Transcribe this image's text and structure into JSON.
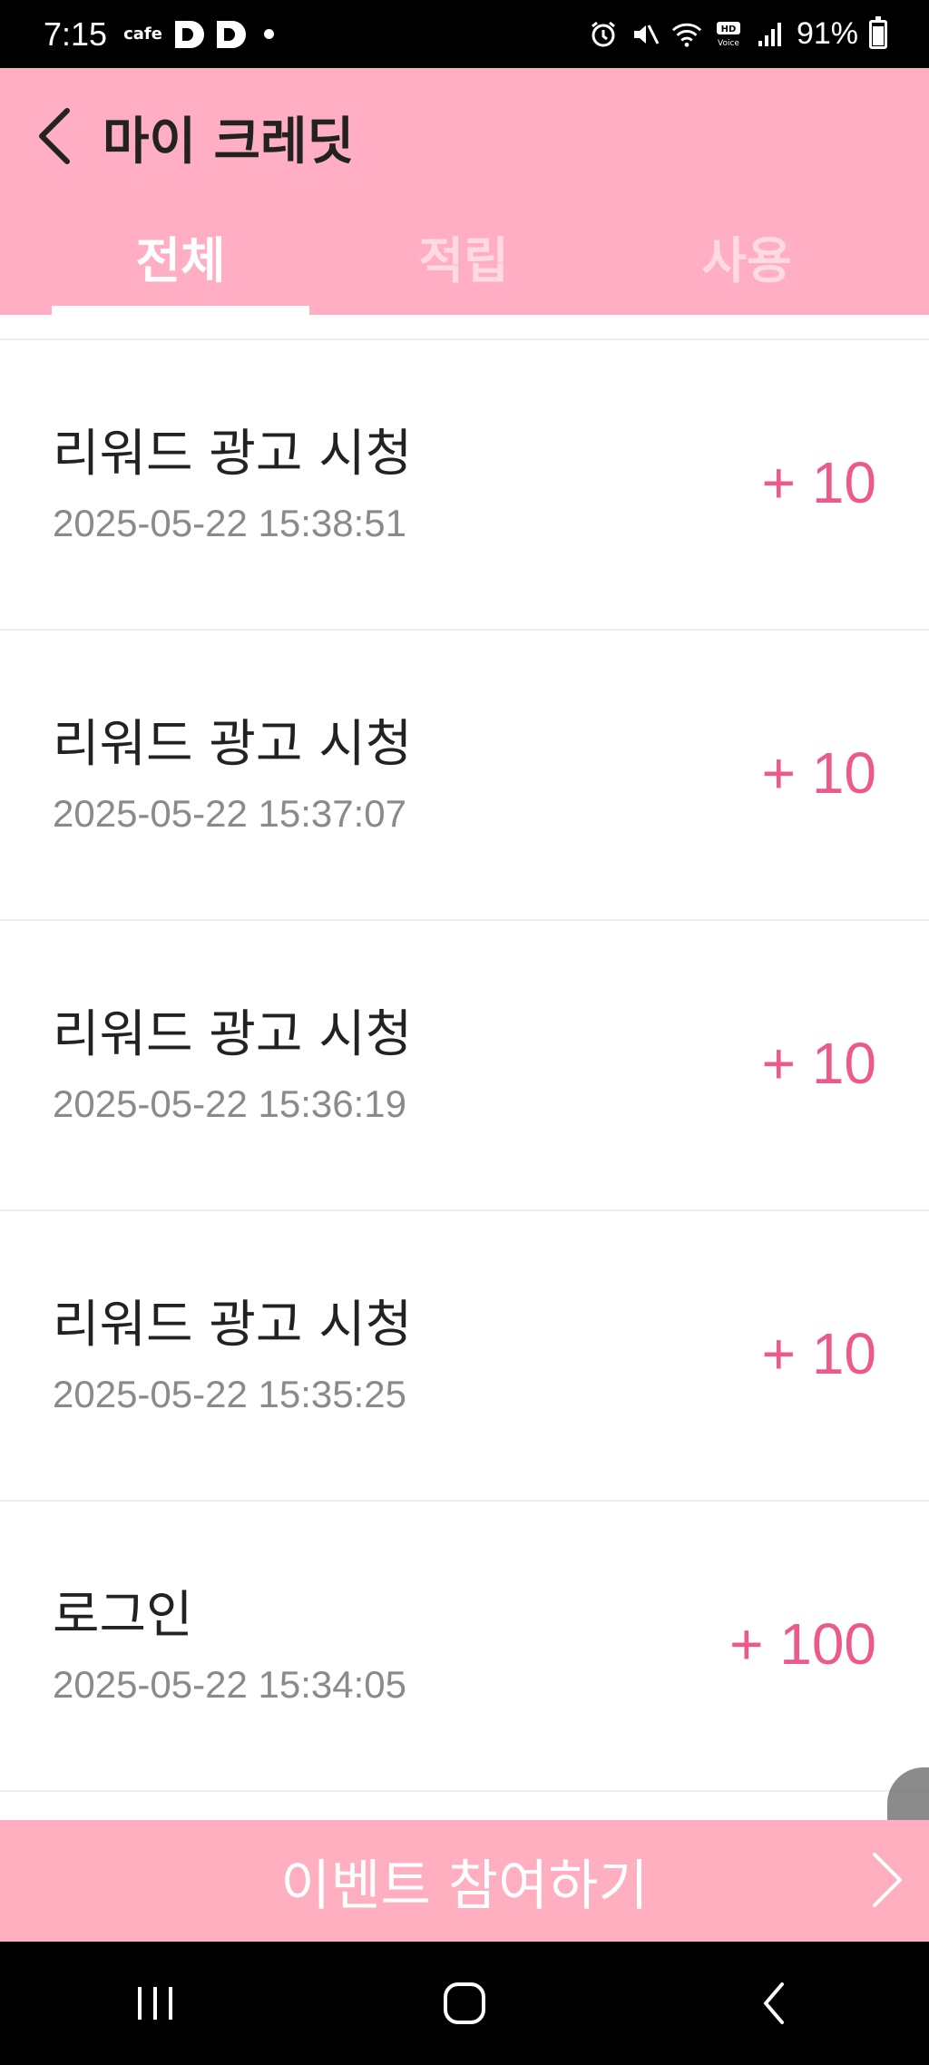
{
  "status_bar": {
    "time": "7:15",
    "cafe_label": "cafe",
    "battery_percent": "91%",
    "icons": [
      "d-app-icon",
      "d-app-icon",
      "dot-icon",
      "alarm-icon",
      "mute-icon",
      "wifi-icon",
      "hd-voice-icon",
      "signal-icon",
      "battery-icon"
    ]
  },
  "header": {
    "title": "마이 크레딧",
    "back_icon": "chevron-left-icon",
    "background": "#ffaec4"
  },
  "tabs": [
    {
      "label": "전체",
      "active": true
    },
    {
      "label": "적립",
      "active": false
    },
    {
      "label": "사용",
      "active": false
    }
  ],
  "history": [
    {
      "title": "리워드 광고 시청",
      "date": "2025-05-22 15:38:51",
      "amount": "+ 10"
    },
    {
      "title": "리워드 광고 시청",
      "date": "2025-05-22 15:37:07",
      "amount": "+ 10"
    },
    {
      "title": "리워드 광고 시청",
      "date": "2025-05-22 15:36:19",
      "amount": "+ 10"
    },
    {
      "title": "리워드 광고 시청",
      "date": "2025-05-22 15:35:25",
      "amount": "+ 10"
    },
    {
      "title": "로그인",
      "date": "2025-05-22 15:34:05",
      "amount": "+ 100"
    }
  ],
  "event_bar": {
    "label": "이벤트 참여하기"
  },
  "colors": {
    "accent": "#ec5a8c",
    "header": "#ffaec4",
    "event_bar": "#ffafc0"
  }
}
